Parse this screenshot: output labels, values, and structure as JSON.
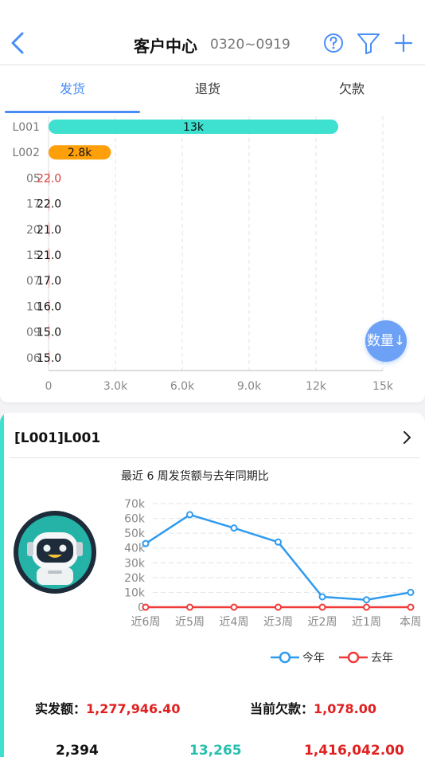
{
  "header": {
    "title": "客户中心",
    "date_range": "0320~0919"
  },
  "tabs": [
    {
      "label": "发货",
      "active": true
    },
    {
      "label": "退货",
      "active": false
    },
    {
      "label": "欠款",
      "active": false
    }
  ],
  "sort_button": {
    "label": "数量↓"
  },
  "colors": {
    "accent": "#4a8df6",
    "teal": "#3ee0cf",
    "orange": "#ff9f0a",
    "this_year": "#2f9bf0",
    "last_year": "#f03a3a"
  },
  "chart_data": [
    {
      "type": "bar",
      "orientation": "horizontal",
      "categories": [
        "L001",
        "L002",
        "05",
        "17",
        "20",
        "15",
        "07",
        "10",
        "09",
        "06"
      ],
      "values": [
        13000,
        2800,
        22.0,
        22.0,
        21.0,
        21.0,
        17.0,
        16.0,
        15.0,
        15.0
      ],
      "data_labels": [
        "13k",
        "2.8k",
        "22.0",
        "22.0",
        "21.0",
        "21.0",
        "17.0",
        "16.0",
        "15.0",
        "15.0"
      ],
      "xlim": [
        0,
        15000
      ],
      "x_ticks": [
        "0",
        "3.0k",
        "6.0k",
        "9.0k",
        "12k",
        "15k"
      ]
    },
    {
      "type": "line",
      "title": "最近 6 周发货额与去年同期比",
      "categories": [
        "近6周",
        "近5周",
        "近4周",
        "近3周",
        "近2周",
        "近1周",
        "本周"
      ],
      "series": [
        {
          "name": "今年",
          "values": [
            43000,
            62500,
            53500,
            44000,
            7000,
            5000,
            10000
          ]
        },
        {
          "name": "去年",
          "values": [
            0,
            0,
            0,
            0,
            0,
            0,
            0
          ]
        }
      ],
      "ylim": [
        0,
        70000
      ],
      "y_ticks": [
        "0",
        "10k",
        "20k",
        "30k",
        "40k",
        "50k",
        "60k",
        "70k"
      ]
    }
  ],
  "customer": {
    "title": "[L001]L001",
    "shipped_label": "实发额：",
    "shipped_value": "1,277,946.40",
    "debt_label": "当前欠款：",
    "debt_value": "1,078.00",
    "bottom_values": [
      "2,394",
      "13,265",
      "1,416,042.00"
    ]
  }
}
